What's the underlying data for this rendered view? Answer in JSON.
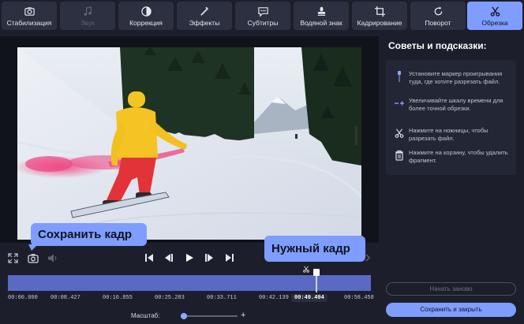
{
  "toolbar": {
    "tools": [
      {
        "label": "Стабилизация",
        "icon": "stabilization-camera-icon",
        "state": "normal"
      },
      {
        "label": "Звук",
        "icon": "music-note-icon",
        "state": "disabled"
      },
      {
        "label": "Коррекция",
        "icon": "contrast-circle-icon",
        "state": "normal"
      },
      {
        "label": "Эффекты",
        "icon": "magic-wand-icon",
        "state": "normal"
      },
      {
        "label": "Субтитры",
        "icon": "speech-bubble-icon",
        "state": "normal"
      },
      {
        "label": "Водяной знак",
        "icon": "stamp-icon",
        "state": "normal"
      },
      {
        "label": "Кадрирование",
        "icon": "crop-icon",
        "state": "normal"
      },
      {
        "label": "Поворот",
        "icon": "rotate-icon",
        "state": "normal"
      },
      {
        "label": "Обрезка",
        "icon": "scissors-icon",
        "state": "active"
      }
    ]
  },
  "tips": {
    "title": "Советы и подсказки:",
    "items": [
      {
        "icon": "playhead-marker-icon",
        "text": "Установите маркер проигрывания туда, где хотите разрезать файл."
      },
      {
        "icon": "zoom-scale-icon",
        "text": "Увеличивайте шкалу времени для более точной обрезки."
      },
      {
        "icon": "scissors-icon",
        "text": "Нажмите на ножницы, чтобы разрезать файл."
      },
      {
        "icon": "trash-icon",
        "text": "Нажмите на корзину, чтобы удалить фрагмент."
      }
    ]
  },
  "callouts": {
    "save_frame": "Сохранить кадр",
    "needed_frame": "Нужный кадр"
  },
  "timeline": {
    "ticks": [
      "00:00.000",
      "00:08.427",
      "00:16.855",
      "00:25.283",
      "00:33.711",
      "00:42.139",
      "00:49.494",
      "00:58.458"
    ],
    "current": "00:49.494",
    "playhead_fraction": 0.85
  },
  "zoom": {
    "label": "Масштаб:",
    "level_fraction": 0.05
  },
  "buttons": {
    "start_cut": "Начать заново",
    "save_close": "Сохранить и закрыть"
  },
  "colors": {
    "accent": "#7f9dff",
    "timeline": "#5a69c4",
    "background": "#1c1f2b"
  }
}
